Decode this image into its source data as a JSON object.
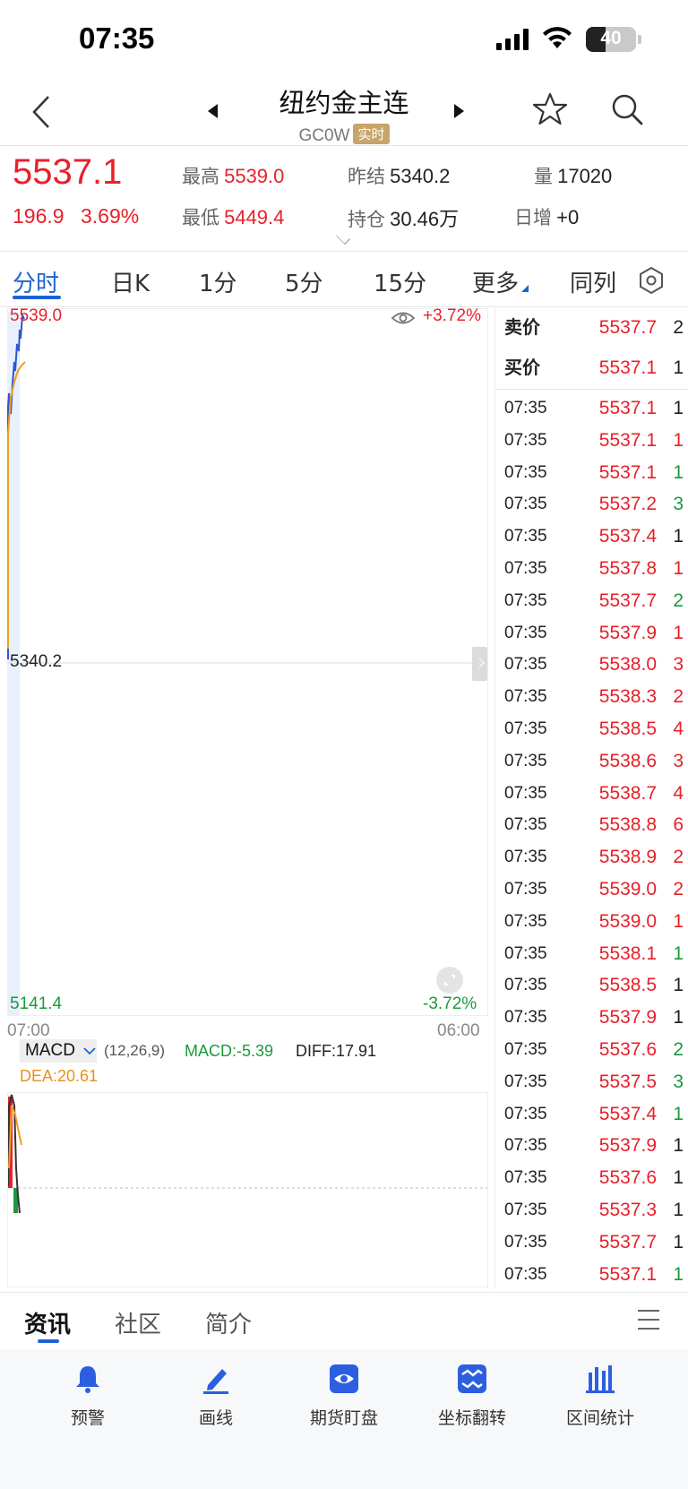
{
  "status_bar": {
    "time": "07:35",
    "battery": "40"
  },
  "header": {
    "title": "纽约金主连",
    "code": "GC0W",
    "badge": "实时"
  },
  "quote": {
    "last": "5537.1",
    "change": "196.9",
    "change_pct": "3.69%",
    "high_label": "最高",
    "high": "5539.0",
    "low_label": "最低",
    "low": "5449.4",
    "prev_settle_label": "昨结",
    "prev_settle": "5340.2",
    "open_interest_label": "持仓",
    "open_interest": "30.46万",
    "volume_label": "量",
    "volume": "17020",
    "daily_inc_label": "日增",
    "daily_inc": "+0"
  },
  "tabs": [
    "分时",
    "日K",
    "1分",
    "5分",
    "15分",
    "更多",
    "同列"
  ],
  "chart": {
    "top_price": "5539.0",
    "top_pct": "+3.72%",
    "mid_price": "5340.2",
    "bottom_price": "5141.4",
    "bottom_pct": "-3.72%",
    "time_start": "07:00",
    "time_end": "06:00"
  },
  "macd": {
    "name": "MACD",
    "params": "(12,26,9)",
    "macd": "MACD:-5.39",
    "diff": "DIFF:17.91",
    "dea": "DEA:20.61"
  },
  "book": {
    "ask_label": "卖价",
    "ask_price": "5537.7",
    "ask_vol": "2",
    "bid_label": "买价",
    "bid_price": "5537.1",
    "bid_vol": "1",
    "trades": [
      {
        "t": "07:35",
        "p": "5537.1",
        "v": "1",
        "c": "dark"
      },
      {
        "t": "07:35",
        "p": "5537.1",
        "v": "1",
        "c": "red"
      },
      {
        "t": "07:35",
        "p": "5537.1",
        "v": "1",
        "c": "green"
      },
      {
        "t": "07:35",
        "p": "5537.2",
        "v": "3",
        "c": "green"
      },
      {
        "t": "07:35",
        "p": "5537.4",
        "v": "1",
        "c": "dark"
      },
      {
        "t": "07:35",
        "p": "5537.8",
        "v": "1",
        "c": "red"
      },
      {
        "t": "07:35",
        "p": "5537.7",
        "v": "2",
        "c": "green"
      },
      {
        "t": "07:35",
        "p": "5537.9",
        "v": "1",
        "c": "red"
      },
      {
        "t": "07:35",
        "p": "5538.0",
        "v": "3",
        "c": "red"
      },
      {
        "t": "07:35",
        "p": "5538.3",
        "v": "2",
        "c": "red"
      },
      {
        "t": "07:35",
        "p": "5538.5",
        "v": "4",
        "c": "red"
      },
      {
        "t": "07:35",
        "p": "5538.6",
        "v": "3",
        "c": "red"
      },
      {
        "t": "07:35",
        "p": "5538.7",
        "v": "4",
        "c": "red"
      },
      {
        "t": "07:35",
        "p": "5538.8",
        "v": "6",
        "c": "red"
      },
      {
        "t": "07:35",
        "p": "5538.9",
        "v": "2",
        "c": "red"
      },
      {
        "t": "07:35",
        "p": "5539.0",
        "v": "2",
        "c": "red"
      },
      {
        "t": "07:35",
        "p": "5539.0",
        "v": "1",
        "c": "red"
      },
      {
        "t": "07:35",
        "p": "5538.1",
        "v": "1",
        "c": "green"
      },
      {
        "t": "07:35",
        "p": "5538.5",
        "v": "1",
        "c": "dark"
      },
      {
        "t": "07:35",
        "p": "5537.9",
        "v": "1",
        "c": "dark"
      },
      {
        "t": "07:35",
        "p": "5537.6",
        "v": "2",
        "c": "green"
      },
      {
        "t": "07:35",
        "p": "5537.5",
        "v": "3",
        "c": "green"
      },
      {
        "t": "07:35",
        "p": "5537.4",
        "v": "1",
        "c": "green"
      },
      {
        "t": "07:35",
        "p": "5537.9",
        "v": "1",
        "c": "dark"
      },
      {
        "t": "07:35",
        "p": "5537.6",
        "v": "1",
        "c": "dark"
      },
      {
        "t": "07:35",
        "p": "5537.3",
        "v": "1",
        "c": "dark"
      },
      {
        "t": "07:35",
        "p": "5537.7",
        "v": "1",
        "c": "dark"
      },
      {
        "t": "07:35",
        "p": "5537.1",
        "v": "1",
        "c": "green"
      }
    ]
  },
  "bottom_tabs": [
    "资讯",
    "社区",
    "简介"
  ],
  "toolbar": [
    "预警",
    "画线",
    "期货盯盘",
    "坐标翻转",
    "区间统计"
  ],
  "colors": {
    "up": "#e8202a",
    "down": "#1a9a3c",
    "accent": "#1e63d6"
  }
}
